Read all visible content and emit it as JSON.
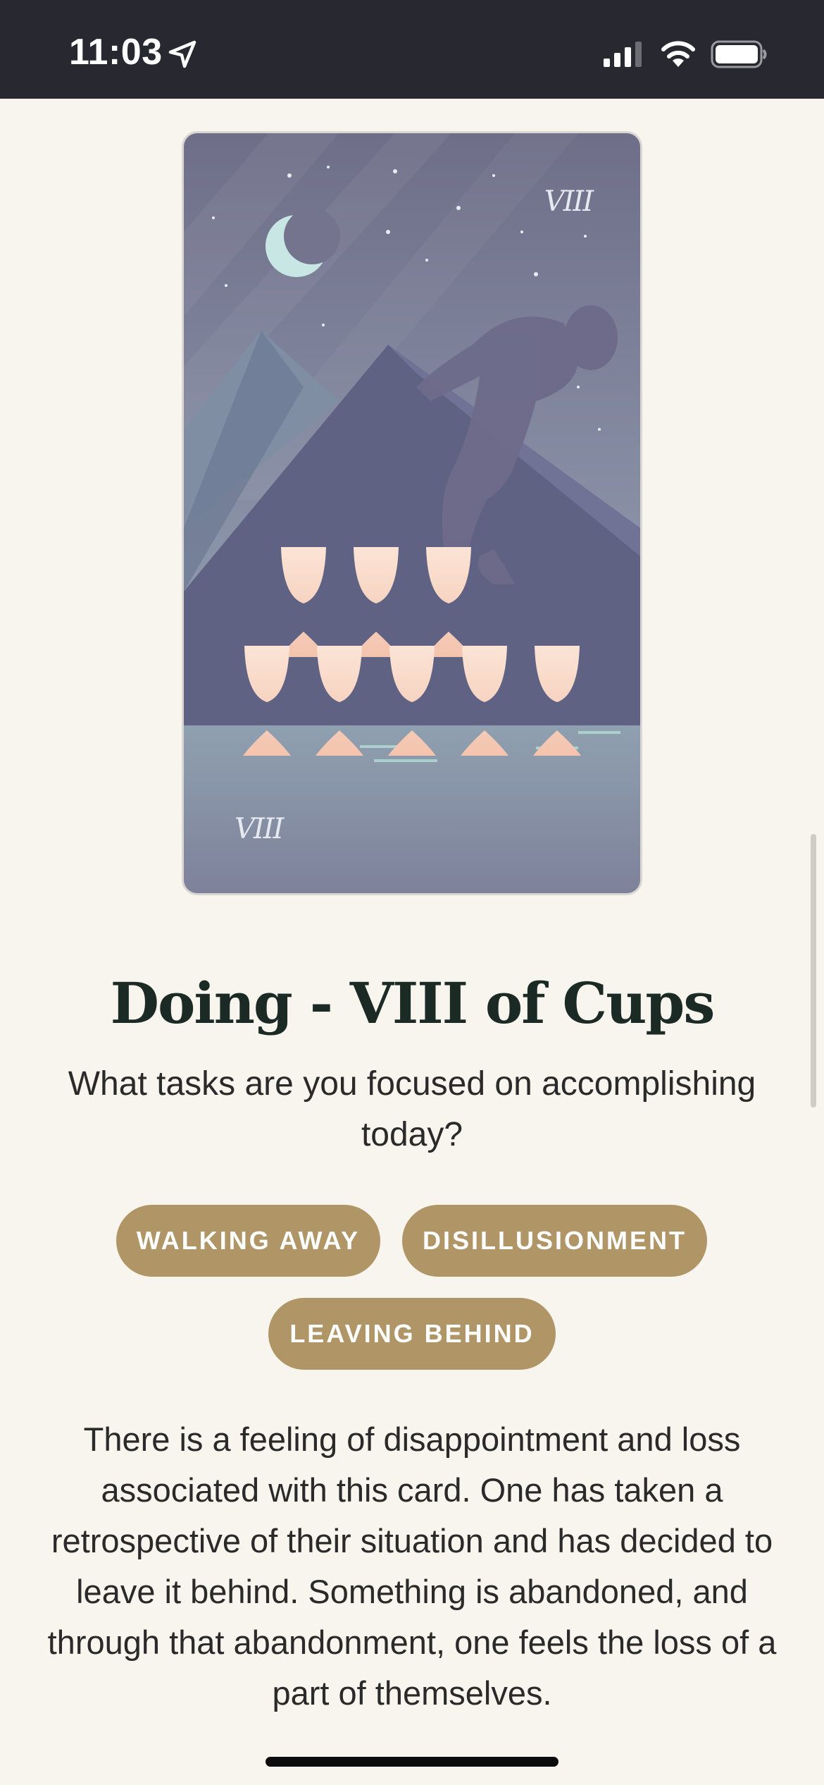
{
  "status_bar": {
    "time": "11:03",
    "icons": [
      "location-arrow-icon",
      "cellular-signal-icon",
      "wifi-icon",
      "battery-icon"
    ]
  },
  "card": {
    "numeral_top": "VIII",
    "numeral_bottom": "VIII",
    "image": "eight-of-cups-illustration"
  },
  "content": {
    "title": "Doing - VIII of Cups",
    "question": "What tasks are you focused on accomplishing today?",
    "tags": [
      "WALKING AWAY",
      "DISILLUSIONMENT",
      "LEAVING BEHIND"
    ],
    "description": "There is a feeling of disappointment and loss associated with this card. One has taken a retrospective of their situation and has decided to leave it behind. Something is abandoned, and through that abandonment, one feels the loss of a part of themselves."
  },
  "colors": {
    "background": "#f8f5ee",
    "status_bar": "#282830",
    "tag": "#b09566",
    "title": "#1c2a26"
  }
}
